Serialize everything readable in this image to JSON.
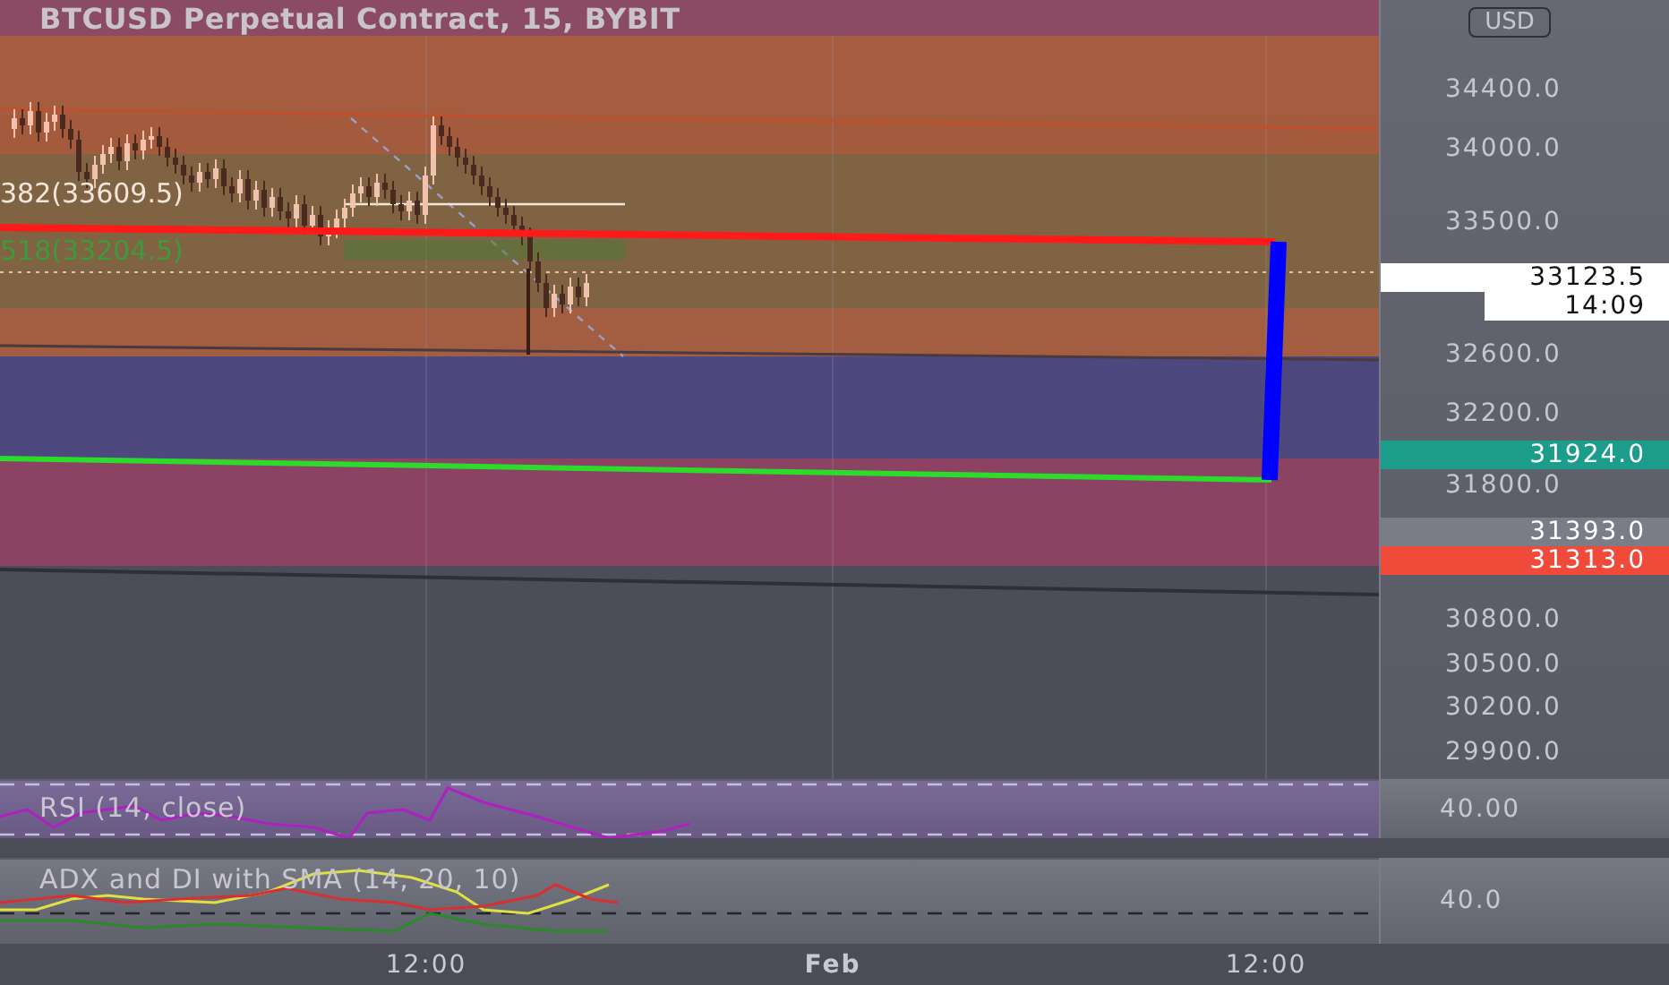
{
  "chart": {
    "title": "BTCUSD Perpetual Contract, 15, BYBIT",
    "fib_labels": [
      {
        "text": "382(33609.5)",
        "color": "#f2e6dc"
      },
      {
        "text": "518(33204.5)",
        "color": "#3f9a3c"
      }
    ]
  },
  "price_axis": {
    "currency_button": "USD",
    "ticks": [
      "34400.0",
      "34000.0",
      "33500.0",
      "32600.0",
      "32200.0",
      "31800.0",
      "30800.0",
      "30500.0",
      "30200.0",
      "29900.0"
    ],
    "badges": [
      {
        "text": "33123.5",
        "kind": "price",
        "color": "#ffffff"
      },
      {
        "text": "14:09",
        "kind": "countdown",
        "color": "#ffffff"
      },
      {
        "text": "31924.0",
        "kind": "price",
        "color": "#1c9c8a"
      },
      {
        "text": "31393.0",
        "kind": "price",
        "color": "#7a7d88"
      },
      {
        "text": "31313.0",
        "kind": "price",
        "color": "#f04a3a"
      }
    ]
  },
  "indicators": [
    {
      "kind": "rsi",
      "label": "RSI (14, close)",
      "axis_value": "40.00"
    },
    {
      "kind": "adx",
      "label": "ADX and DI with SMA (14, 20, 10)",
      "axis_value": "40.0"
    }
  ],
  "time_axis": [
    {
      "text": "12:00",
      "kind": "time"
    },
    {
      "text": "Feb",
      "kind": "month"
    },
    {
      "text": "12:00",
      "kind": "time"
    }
  ]
}
